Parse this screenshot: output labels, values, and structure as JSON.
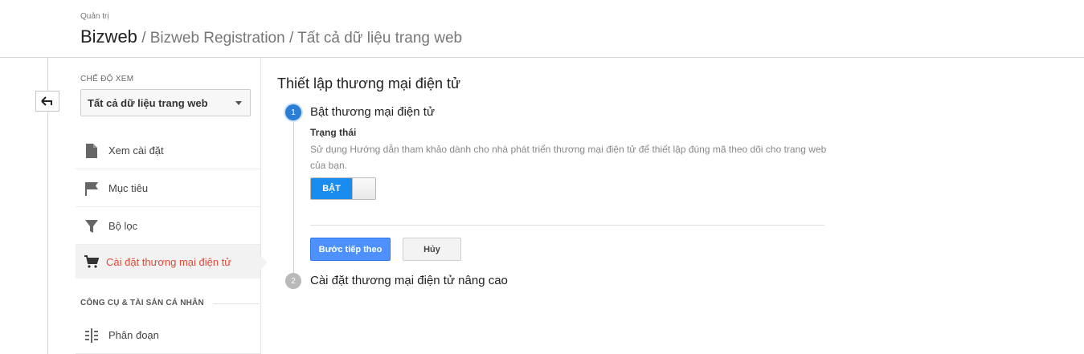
{
  "header": {
    "small_label": "Quản trị",
    "account": "Bizweb",
    "breadcrumb": " / Bizweb Registration / Tất cả dữ liệu trang web"
  },
  "sidebar": {
    "view_label": "CHẾ ĐỘ XEM",
    "view_value": "Tất cả dữ liệu trang web",
    "items": [
      {
        "label": "Xem cài đặt",
        "icon": "document-icon"
      },
      {
        "label": "Mục tiêu",
        "icon": "flag-icon"
      },
      {
        "label": "Bộ lọc",
        "icon": "filter-icon"
      },
      {
        "label": "Cài đặt thương mại điện tử",
        "icon": "cart-icon",
        "active": true
      }
    ],
    "tools_label": "CÔNG CỤ & TÀI SẢN CÁ NHÂN",
    "tools_items": [
      {
        "label": "Phân đoạn",
        "icon": "segments-icon"
      }
    ]
  },
  "main": {
    "title": "Thiết lập thương mại điện tử",
    "step1": {
      "number": "1",
      "title": "Bật thương mại điện tử",
      "status_label": "Trạng thái",
      "description": "Sử dụng Hướng dẫn tham khảo dành cho nhà phát triển thương mại điện tử để thiết lập đúng mã theo dõi cho trang web của bạn.",
      "toggle_label": "BẬT"
    },
    "next_button": "Bước tiếp theo",
    "cancel_button": "Hủy",
    "step2": {
      "number": "2",
      "title": "Cài đặt thương mại điện tử nâng cao"
    }
  },
  "colors": {
    "accent": "#4d90fe",
    "active_item": "#dd4b39",
    "toggle_on": "#1a8cf0",
    "step_active": "#2a7fd4"
  }
}
